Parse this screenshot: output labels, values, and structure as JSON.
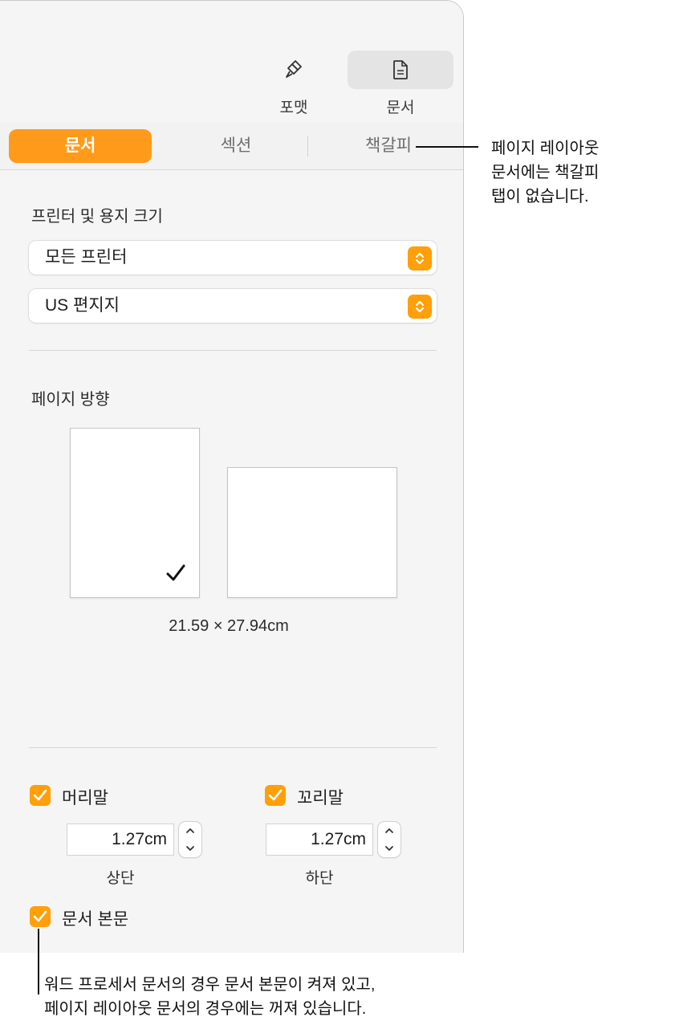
{
  "toolbar": {
    "format_label": "포맷",
    "document_label": "문서"
  },
  "tabs": {
    "document": "문서",
    "section": "섹션",
    "bookmarks": "책갈피"
  },
  "printer": {
    "title": "프린터 및 용지 크기",
    "printer_value": "모든 프린터",
    "paper_value": "US 편지지"
  },
  "orientation": {
    "title": "페이지 방향",
    "selected": "portrait",
    "dimensions": "21.59 × 27.94cm"
  },
  "header_footer": {
    "header_label": "머리말",
    "header_checked": true,
    "header_value": "1.27cm",
    "header_sub": "상단",
    "footer_label": "꼬리말",
    "footer_checked": true,
    "footer_value": "1.27cm",
    "footer_sub": "하단",
    "body_label": "문서 본문",
    "body_checked": true
  },
  "callouts": {
    "bookmarks_note": [
      "페이지 레이아웃",
      "문서에는 책갈피",
      "탭이 없습니다."
    ],
    "body_note": [
      "워드 프로세서 문서의 경우 문서 본문이 켜져 있고,",
      "페이지 레이아웃 문서의 경우에는 꺼져 있습니다."
    ]
  },
  "colors": {
    "accent": "#ff9f0a",
    "panel_bg": "#f5f5f5"
  },
  "icons": {
    "format": "paintbrush-icon",
    "document": "document-icon"
  }
}
